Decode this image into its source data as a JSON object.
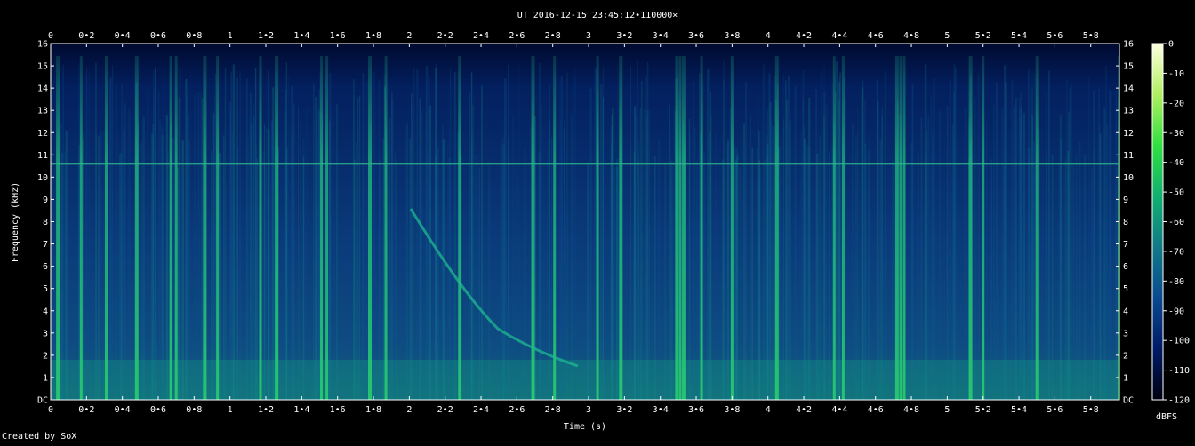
{
  "chart_data": {
    "type": "heatmap",
    "title": "UT 2016-12-15 23:45:12•110000×",
    "xlabel": "Time (s)",
    "ylabel": "Frequency (kHz)",
    "xlim": [
      0,
      5.96
    ],
    "ylim": [
      0,
      16
    ],
    "x_ticks": [
      "0",
      "0•2",
      "0•4",
      "0•6",
      "0•8",
      "1",
      "1•2",
      "1•4",
      "1•6",
      "1•8",
      "2",
      "2•2",
      "2•4",
      "2•6",
      "2•8",
      "3",
      "3•2",
      "3•4",
      "3•6",
      "3•8",
      "4",
      "4•2",
      "4•4",
      "4•6",
      "4•8",
      "5",
      "5•2",
      "5•4",
      "5•6",
      "5•8"
    ],
    "x_tick_values": [
      0,
      0.2,
      0.4,
      0.6,
      0.8,
      1.0,
      1.2,
      1.4,
      1.6,
      1.8,
      2.0,
      2.2,
      2.4,
      2.6,
      2.8,
      3.0,
      3.2,
      3.4,
      3.6,
      3.8,
      4.0,
      4.2,
      4.4,
      4.6,
      4.8,
      5.0,
      5.2,
      5.4,
      5.6,
      5.8
    ],
    "y_ticks": [
      "DC",
      "1",
      "2",
      "3",
      "4",
      "5",
      "6",
      "7",
      "8",
      "9",
      "10",
      "11",
      "12",
      "13",
      "14",
      "15",
      "16"
    ],
    "y_tick_values": [
      0,
      1,
      2,
      3,
      4,
      5,
      6,
      7,
      8,
      9,
      10,
      11,
      12,
      13,
      14,
      15,
      16
    ],
    "colorbar": {
      "label": "dBFS",
      "ticks": [
        "0",
        "-10",
        "-20",
        "-30",
        "-40",
        "-50",
        "-60",
        "-70",
        "-80",
        "-90",
        "-100",
        "-110",
        "-120"
      ],
      "tick_values": [
        0,
        -10,
        -20,
        -30,
        -40,
        -50,
        -60,
        -70,
        -80,
        -90,
        -100,
        -110,
        -120
      ],
      "range": [
        -120,
        0
      ],
      "colors": [
        "#000010",
        "#001a66",
        "#0a4a90",
        "#107a86",
        "#10b070",
        "#30e040",
        "#b0f060",
        "#ffffe0"
      ]
    },
    "features": {
      "carrier_line_khz": 10.6,
      "broadband_impulses_s": [
        0.04,
        0.17,
        0.31,
        0.48,
        0.67,
        0.7,
        0.86,
        0.93,
        1.17,
        1.26,
        1.51,
        1.54,
        1.78,
        1.87,
        2.28,
        2.69,
        2.81,
        3.05,
        3.18,
        3.49,
        3.51,
        3.53,
        3.63,
        3.8,
        4.05,
        4.37,
        4.42,
        4.72,
        4.74,
        4.76,
        5.13,
        5.2,
        5.5,
        5.96
      ]
    },
    "credit": "Created by SoX"
  }
}
